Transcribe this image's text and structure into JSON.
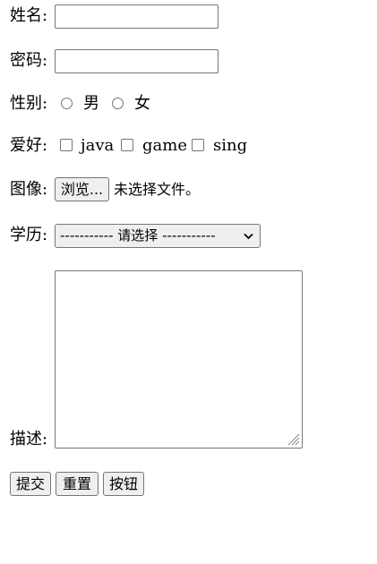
{
  "form": {
    "name": {
      "label": "姓名:",
      "value": ""
    },
    "password": {
      "label": "密码:",
      "value": ""
    },
    "gender": {
      "label": "性别:",
      "options": [
        "男",
        "女"
      ]
    },
    "hobby": {
      "label": "爱好:",
      "options": [
        "java",
        "game",
        "sing"
      ]
    },
    "image": {
      "label": "图像:",
      "button_label": "浏览...",
      "status": "未选择文件。"
    },
    "education": {
      "label": "学历:",
      "selected": "----------- 请选择 -----------"
    },
    "description": {
      "label": "描述:",
      "value": ""
    },
    "buttons": {
      "submit": "提交",
      "reset": "重置",
      "button": "按钮"
    }
  }
}
